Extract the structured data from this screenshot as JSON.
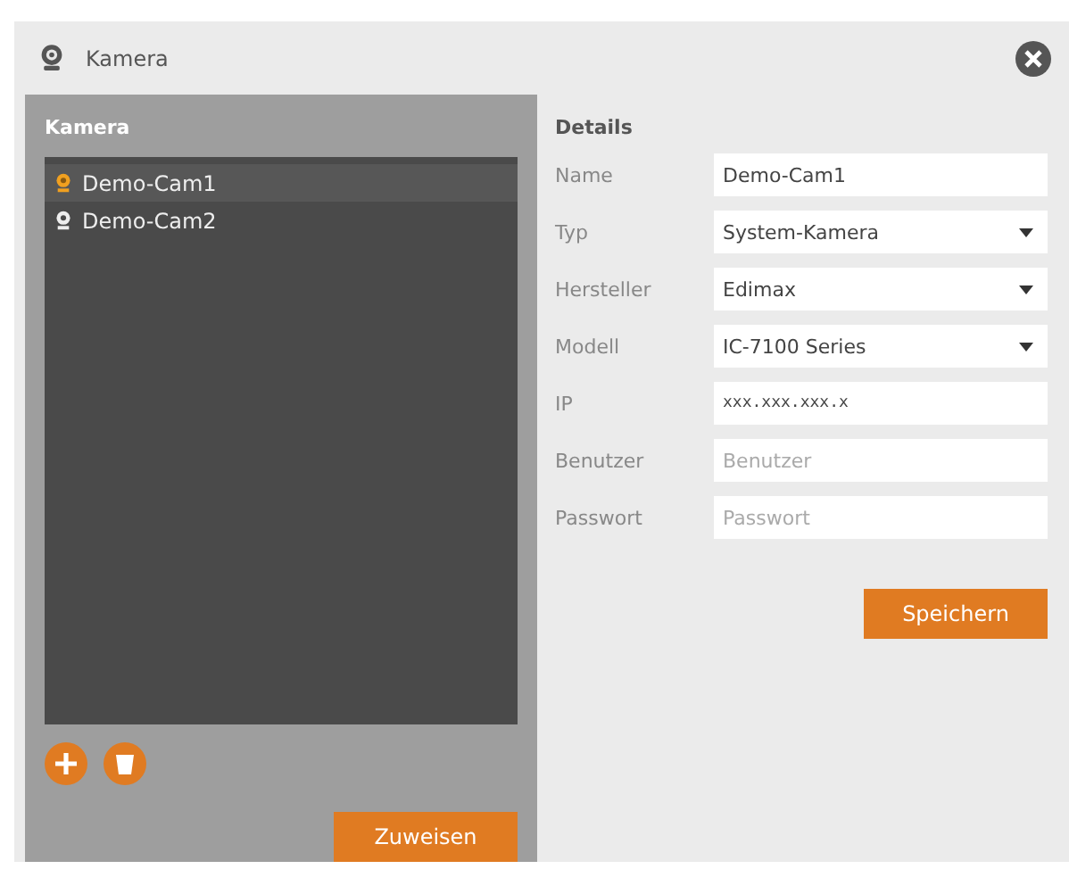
{
  "window": {
    "title": "Kamera"
  },
  "camera_panel": {
    "title": "Kamera",
    "items": [
      {
        "label": "Demo-Cam1",
        "selected": true
      },
      {
        "label": "Demo-Cam2",
        "selected": false
      }
    ],
    "assign_button": "Zuweisen"
  },
  "details": {
    "title": "Details",
    "fields": [
      {
        "kind": "text",
        "label": "Name",
        "value": "Demo-Cam1"
      },
      {
        "kind": "select",
        "label": "Typ",
        "value": "System-Kamera"
      },
      {
        "kind": "select",
        "label": "Hersteller",
        "value": "Edimax"
      },
      {
        "kind": "select",
        "label": "Modell",
        "value": "IC-7100 Series"
      },
      {
        "kind": "ip",
        "label": "IP",
        "value": "xxx.xxx.xxx.x"
      },
      {
        "kind": "text",
        "label": "Benutzer",
        "placeholder": "Benutzer"
      },
      {
        "kind": "text",
        "label": "Passwort",
        "placeholder": "Passwort"
      }
    ],
    "save_button": "Speichern"
  }
}
